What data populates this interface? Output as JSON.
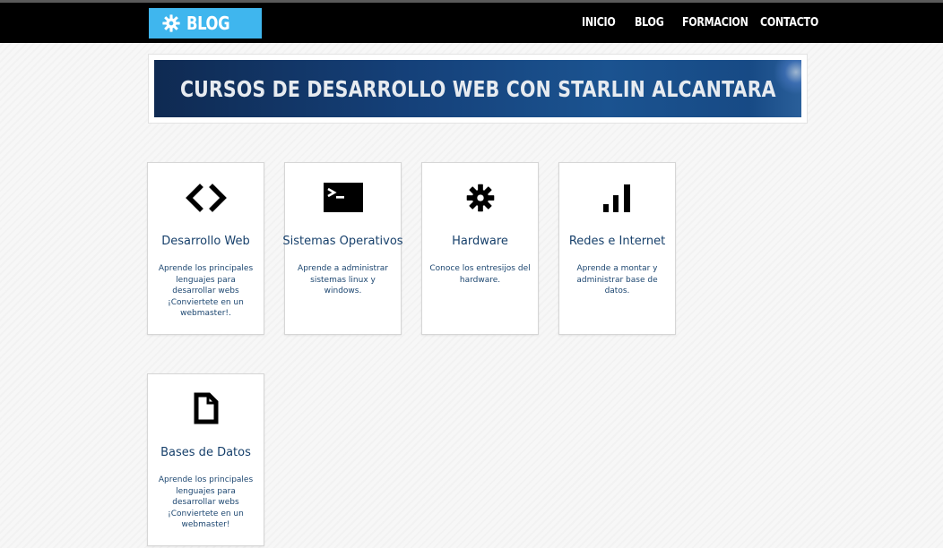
{
  "header": {
    "logo_text": "BLOG",
    "nav": [
      "INICIO",
      "BLOG",
      "FORMACION",
      "CONTACTO"
    ]
  },
  "banner": {
    "title": "CURSOS DE DESARROLLO WEB CON STARLIN ALCANTARA"
  },
  "cards": [
    {
      "title": "Desarrollo Web",
      "description": "Aprende los principales lenguajes para desarrollar webs ¡Conviertete en un webmaster!.",
      "icon": "code-icon"
    },
    {
      "title": "Sistemas Operativos",
      "description": "Aprende a administrar sistemas linux y windows.",
      "icon": "terminal-icon"
    },
    {
      "title": "Hardware",
      "description": "Conoce los entresijos del hardware.",
      "icon": "gear-icon"
    },
    {
      "title": "Redes e Internet",
      "description": "Aprende a montar y administrar base de datos.",
      "icon": "signal-bars-icon"
    },
    {
      "title": "Bases de Datos",
      "description": "Aprende los principales lenguajes para desarrollar webs ¡Conviertete en un webmaster!",
      "icon": "document-icon"
    }
  ],
  "colors": {
    "accent": "#3fb6ee",
    "navbar": "#000000",
    "card_title": "#17406b",
    "banner": "#15417a"
  }
}
